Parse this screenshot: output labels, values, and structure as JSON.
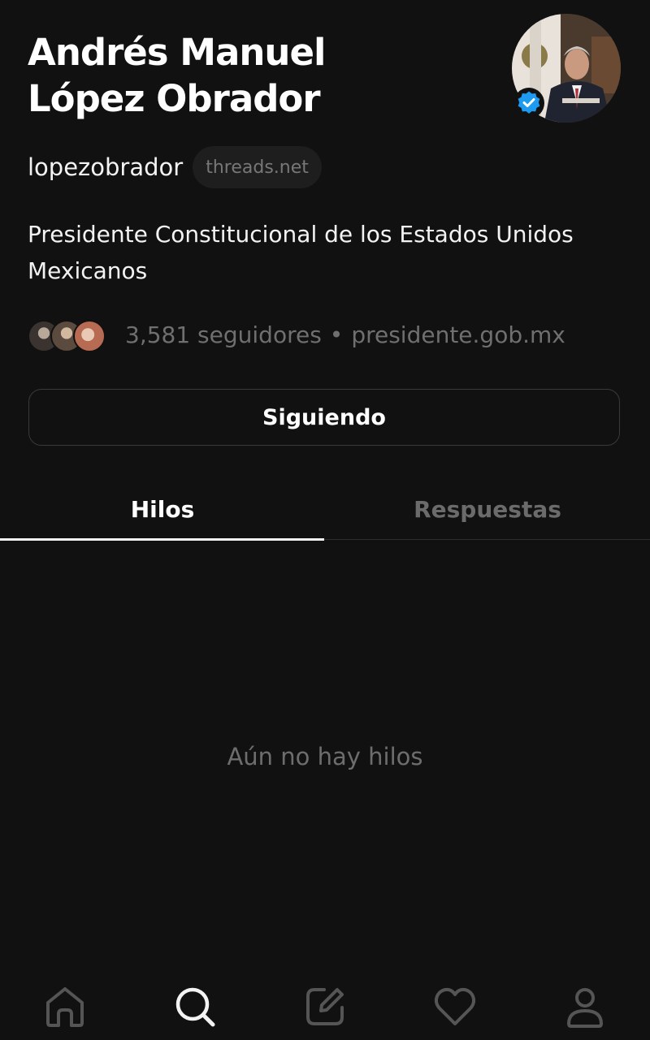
{
  "profile": {
    "name_line1": "Andrés Manuel",
    "name_line2": "López Obrador",
    "handle": "lopezobrador",
    "domain": "threads.net",
    "bio": "Presidente Constitucional de los Estados Unidos Mexicanos",
    "followers": "3,581 seguidores",
    "separator": "•",
    "link": "presidente.gob.mx",
    "verified": true
  },
  "actions": {
    "follow_button": "Siguiendo"
  },
  "tabs": [
    {
      "label": "Hilos",
      "active": true
    },
    {
      "label": "Respuestas",
      "active": false
    }
  ],
  "content": {
    "empty_message": "Aún no hay hilos"
  },
  "bottom_nav": [
    {
      "icon": "home-icon",
      "active": false
    },
    {
      "icon": "search-icon",
      "active": true
    },
    {
      "icon": "compose-icon",
      "active": false
    },
    {
      "icon": "heart-icon",
      "active": false
    },
    {
      "icon": "profile-icon",
      "active": false
    }
  ],
  "colors": {
    "background": "#111112",
    "text_primary": "#f3f3f3",
    "text_secondary": "#6f6f6f",
    "verified_blue": "#1d9bf0"
  }
}
